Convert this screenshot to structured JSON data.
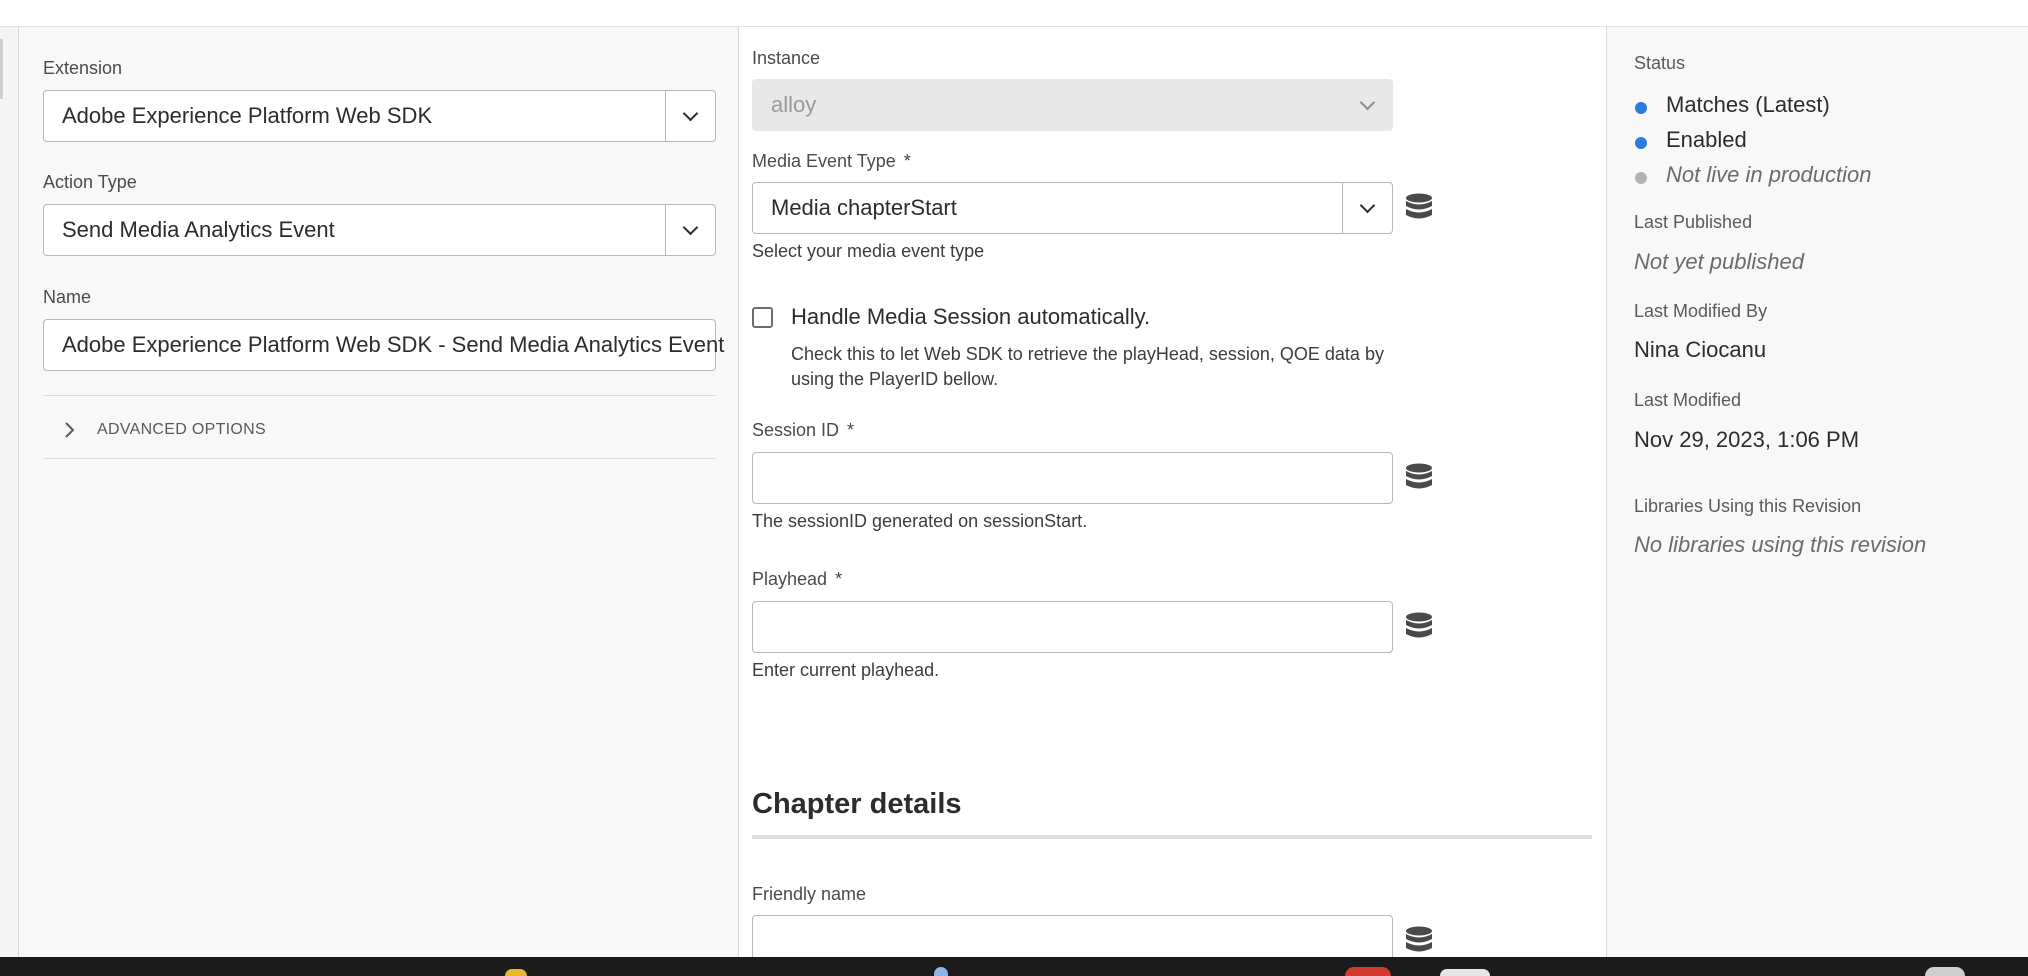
{
  "left_panel": {
    "extension": {
      "label": "Extension",
      "value": "Adobe Experience Platform Web SDK"
    },
    "action_type": {
      "label": "Action Type",
      "value": "Send Media Analytics Event"
    },
    "name": {
      "label": "Name",
      "value": "Adobe Experience Platform Web SDK - Send Media Analytics Event"
    },
    "advanced_options": "ADVANCED OPTIONS"
  },
  "main_panel": {
    "instance": {
      "label": "Instance",
      "value": "alloy"
    },
    "media_event_type": {
      "label": "Media Event Type",
      "required_mark": "*",
      "value": "Media chapterStart",
      "help": "Select your media event type"
    },
    "handle_session": {
      "label": "Handle Media Session automatically.",
      "checked": false,
      "help_line1": "Check this to let Web SDK to retrieve the playHead, session, QOE data by",
      "help_line2": "using the PlayerID bellow."
    },
    "session_id": {
      "label": "Session ID",
      "required_mark": "*",
      "value": "",
      "help": "The sessionID generated on sessionStart."
    },
    "playhead": {
      "label": "Playhead",
      "required_mark": "*",
      "value": "",
      "help": "Enter current playhead."
    },
    "chapter_details": {
      "heading": "Chapter details"
    },
    "friendly_name": {
      "label": "Friendly name",
      "value": ""
    }
  },
  "status_panel": {
    "status_label": "Status",
    "statuses": [
      {
        "text": "Matches (Latest)",
        "color": "#2d7be0",
        "italic": false
      },
      {
        "text": "Enabled",
        "color": "#2d7be0",
        "italic": false
      },
      {
        "text": "Not live in production",
        "color": "#b3b3b3",
        "italic": true
      }
    ],
    "last_published_label": "Last Published",
    "last_published_value": "Not yet published",
    "last_modified_by_label": "Last Modified By",
    "last_modified_by_value": "Nina Ciocanu",
    "last_modified_label": "Last Modified",
    "last_modified_value": "Nov 29, 2023, 1:06 PM",
    "libraries_label": "Libraries Using this Revision",
    "libraries_value": "No libraries using this revision"
  },
  "icons": {
    "data_element": "database-icon",
    "chevron": "chevron-down-icon",
    "expand": "chevron-right-icon"
  }
}
